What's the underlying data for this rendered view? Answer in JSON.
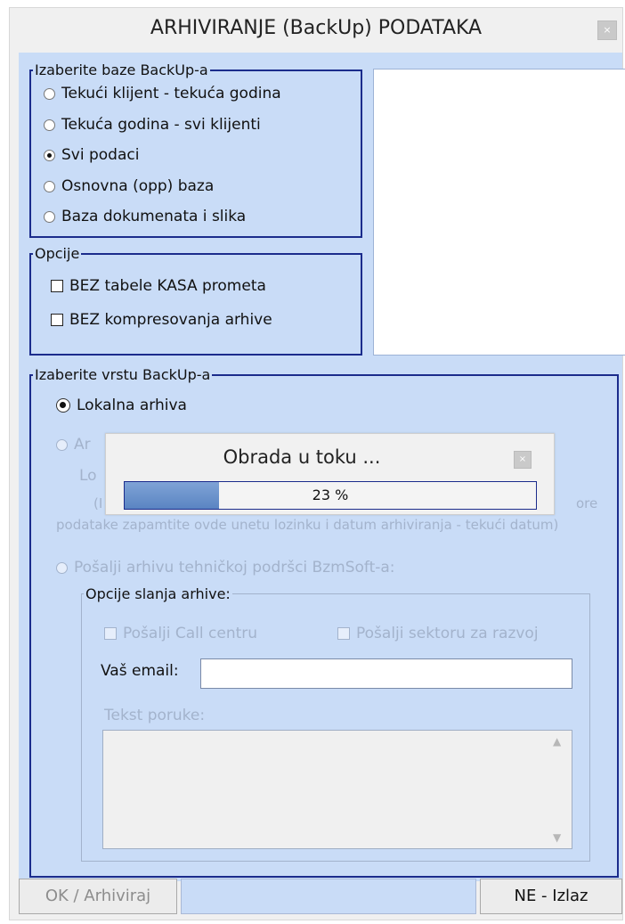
{
  "window": {
    "title": "ARHIVIRANJE (BackUp)  PODATAKA",
    "close_icon": "×"
  },
  "db_group": {
    "legend": "Izaberite baze BackUp-a",
    "options": [
      {
        "label": "Tekući klijent - tekuća godina",
        "selected": false
      },
      {
        "label": "Tekuća godina - svi klijenti",
        "selected": false
      },
      {
        "label": "Svi podaci",
        "selected": true
      },
      {
        "label": "Osnovna (opp) baza",
        "selected": false
      },
      {
        "label": "Baza dokumenata i slika",
        "selected": false
      }
    ]
  },
  "options_group": {
    "legend": "Opcije",
    "items": [
      {
        "label": "BEZ tabele KASA prometa",
        "checked": false
      },
      {
        "label": "BEZ kompresovanja arhive",
        "checked": false
      }
    ]
  },
  "backup_type_group": {
    "legend": "Izaberite vrstu BackUp-a",
    "local": {
      "label": "Lokalna arhiva",
      "selected": true
    },
    "second": {
      "label_fragment": "Ar",
      "line2_fragment": "Lo",
      "line3_start": "(I",
      "line3_end": "ore"
    },
    "note": "podatake zapamtite ovde unetu lozinku i datum arhiviranja - tekući datum)",
    "send_support": {
      "label": "Pošalji arhivu tehničkoj podršci BzmSoft-a:",
      "selected": false
    },
    "send_options": {
      "legend": "Opcije slanja arhive:",
      "call_center": "Pošalji Call centru",
      "dev_sector": "Pošalji sektoru za razvoj",
      "email_label": "Vaš email:",
      "email_value": "",
      "message_label": "Tekst poruke:",
      "message_value": ""
    }
  },
  "progress_dialog": {
    "title": "Obrada u toku ...",
    "percent": 23,
    "percent_text": "23 %",
    "close_icon": "×"
  },
  "buttons": {
    "ok": "OK / Arhiviraj",
    "cancel": "NE - Izlaz"
  },
  "colors": {
    "panel": "#c9dcf7",
    "border": "#1b2c8c",
    "progress": "#5a84c2"
  }
}
